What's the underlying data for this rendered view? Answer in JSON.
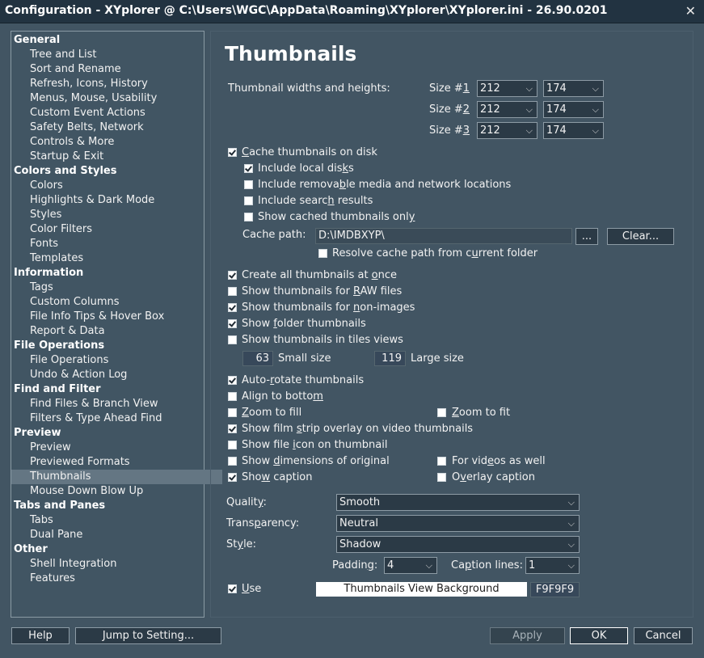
{
  "window": {
    "title": "Configuration - XYplorer @ C:\\Users\\WGC\\AppData\\Roaming\\XYplorer\\XYplorer.ini - 26.90.0201",
    "close_icon": "close-icon"
  },
  "tree": {
    "general": "General",
    "tree_and_list": "Tree and List",
    "sort_and_rename": "Sort and Rename",
    "refresh_icons_history": "Refresh, Icons, History",
    "menus_mouse_usability": "Menus, Mouse, Usability",
    "custom_event_actions": "Custom Event Actions",
    "safety_belts_network": "Safety Belts, Network",
    "controls_more": "Controls & More",
    "startup_exit": "Startup & Exit",
    "colors_and_styles": "Colors and Styles",
    "colors": "Colors",
    "highlights_dark_mode": "Highlights & Dark Mode",
    "styles": "Styles",
    "color_filters": "Color Filters",
    "fonts": "Fonts",
    "templates": "Templates",
    "information": "Information",
    "tags": "Tags",
    "custom_columns": "Custom Columns",
    "file_info_tips": "File Info Tips & Hover Box",
    "report_data": "Report & Data",
    "file_operations_cat": "File Operations",
    "file_operations": "File Operations",
    "undo_action_log": "Undo & Action Log",
    "find_and_filter": "Find and Filter",
    "find_files_branch": "Find Files & Branch View",
    "filters_type_ahead": "Filters & Type Ahead Find",
    "preview_cat": "Preview",
    "preview": "Preview",
    "previewed_formats": "Previewed Formats",
    "thumbnails": "Thumbnails",
    "mouse_down_blow_up": "Mouse Down Blow Up",
    "tabs_and_panes": "Tabs and Panes",
    "tabs": "Tabs",
    "dual_pane": "Dual Pane",
    "other": "Other",
    "shell_integration": "Shell Integration",
    "features": "Features"
  },
  "page": {
    "heading": "Thumbnails",
    "sizes_label": "Thumbnail widths and heights:",
    "size_prefix": "Size #",
    "size1_num": "1",
    "size2_num": "2",
    "size3_num": "3",
    "size1_w": "212",
    "size1_h": "174",
    "size2_w": "212",
    "size2_h": "174",
    "size3_w": "212",
    "size3_h": "174",
    "cache_on_disk": {
      "pre": "",
      "u": "C",
      "post": "ache thumbnails on disk",
      "checked": true
    },
    "include_local": {
      "pre": "Include local dis",
      "u": "k",
      "post": "s",
      "checked": true
    },
    "include_removable": {
      "pre": "Include remova",
      "u": "b",
      "post": "le media and network locations",
      "checked": false
    },
    "include_search": {
      "pre": "Include searc",
      "u": "h",
      "post": " results",
      "checked": false
    },
    "show_cached_only": {
      "pre": "Show cached thumbnails onl",
      "u": "y",
      "post": "",
      "checked": false
    },
    "cache_path_label": "Cache path:",
    "cache_path_value": "D:\\IMDBXYP\\",
    "browse_label": "...",
    "clear_label": "Clear...",
    "resolve_cache": {
      "pre": "Resolve cache path from c",
      "u": "u",
      "post": "rrent folder",
      "checked": false
    },
    "create_all": {
      "pre": "Create all thumbnails at ",
      "u": "o",
      "post": "nce",
      "checked": true
    },
    "show_raw": {
      "pre": "Show thumbnails for ",
      "u": "R",
      "post": "AW files",
      "checked": false
    },
    "show_non_images": {
      "pre": "Show thumbnails for ",
      "u": "n",
      "post": "on-images",
      "checked": true
    },
    "show_folder": {
      "pre": "Show ",
      "u": "f",
      "post": "older thumbnails",
      "checked": true
    },
    "show_tiles": {
      "pre": "Show thumbnails in tiles views",
      "u": "",
      "post": "",
      "checked": false
    },
    "small_size_value": "63",
    "small_size_label": "Small size",
    "large_size_value": "119",
    "large_size_label": "Large size",
    "auto_rotate": {
      "pre": "Auto-",
      "u": "r",
      "post": "otate thumbnails",
      "checked": true
    },
    "align_bottom": {
      "pre": "Align to botto",
      "u": "m",
      "post": "",
      "checked": false
    },
    "zoom_fill": {
      "pre": "",
      "u": "Z",
      "post": "oom to fill",
      "checked": false
    },
    "zoom_fit": {
      "pre": "",
      "u": "Z",
      "post": "oom to fit",
      "checked": false
    },
    "film_strip": {
      "pre": "Show film ",
      "u": "s",
      "post": "trip overlay on video thumbnails",
      "checked": true
    },
    "file_icon": {
      "pre": "Show file ",
      "u": "i",
      "post": "con on thumbnail",
      "checked": false
    },
    "dimensions": {
      "pre": "Show ",
      "u": "d",
      "post": "imensions of original",
      "checked": false
    },
    "videos_as_well": {
      "pre": "For vid",
      "u": "e",
      "post": "os as well",
      "checked": false
    },
    "show_caption": {
      "pre": "Sho",
      "u": "w",
      "post": " caption",
      "checked": true
    },
    "overlay_caption": {
      "pre": "O",
      "u": "v",
      "post": "erlay caption",
      "checked": false
    },
    "quality_label": {
      "pre": "Qualit",
      "u": "y",
      "post": ":"
    },
    "quality_value": "Smooth",
    "transparency_label": {
      "pre": "Trans",
      "u": "p",
      "post": "arency:"
    },
    "transparency_value": "Neutral",
    "style_label": {
      "pre": "St",
      "u": "y",
      "post": "le:"
    },
    "style_value": "Shadow",
    "padding_label": {
      "pre": "Paddin",
      "u": "g",
      "post": ":"
    },
    "padding_value": "4",
    "caption_lines_label": {
      "pre": "Ca",
      "u": "p",
      "post": "tion lines:"
    },
    "caption_lines_value": "1",
    "use": {
      "pre": "",
      "u": "U",
      "post": "se",
      "checked": true
    },
    "bg_button_label": "Thumbnails View Background",
    "bg_color": "F9F9F9"
  },
  "footer": {
    "help": "Help",
    "jump": "Jump to Setting...",
    "apply": "Apply",
    "ok": "OK",
    "cancel": "Cancel"
  },
  "colors": {
    "window_bg": "#425563",
    "selected_row": "#647683",
    "titlebar": "#223341"
  }
}
